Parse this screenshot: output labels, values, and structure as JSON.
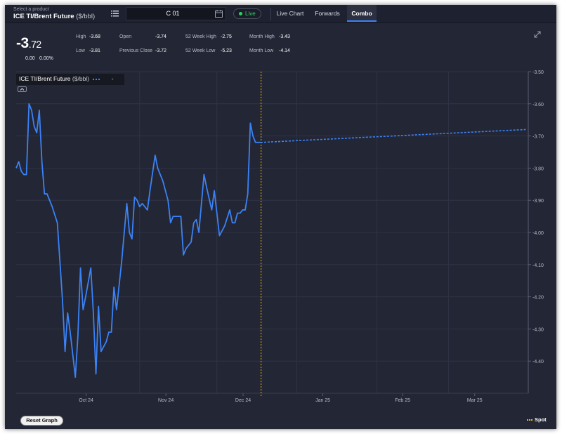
{
  "toolbar": {
    "product_caption": "Select a product",
    "product_name": "ICE TI/Brent Future",
    "product_unit": "($/bbl)",
    "contract": "C 01",
    "live_label": "Live",
    "tabs": [
      {
        "label": "Live Chart",
        "active": false
      },
      {
        "label": "Forwards",
        "active": false
      },
      {
        "label": "Combo",
        "active": true
      }
    ]
  },
  "quote": {
    "price_int": "-3",
    "price_dec": ".72",
    "change": "0.00",
    "change_pct": "0.00%",
    "stats": [
      {
        "label": "High",
        "value": "-3.68"
      },
      {
        "label": "Low",
        "value": "-3.81"
      },
      {
        "label": "Open",
        "value": "-3.74"
      },
      {
        "label": "Previous Close",
        "value": "-3.72"
      },
      {
        "label": "52 Week High",
        "value": "-2.75"
      },
      {
        "label": "52 Week Low",
        "value": "-5.23"
      },
      {
        "label": "Month High",
        "value": "-3.43"
      },
      {
        "label": "Month Low",
        "value": "-4.14"
      }
    ]
  },
  "legend": {
    "title": "ICE TI/Brent Future",
    "unit": "($/bbl)",
    "dash": "-"
  },
  "buttons": {
    "reset": "Reset Graph"
  },
  "spot_legend": "Spot",
  "colors": {
    "background": "#232634",
    "series": "#3b82f6",
    "spot": "#f5b800",
    "live": "#2fd05f"
  },
  "chart_data": {
    "type": "line",
    "title": "ICE TI/Brent Future ($/bbl)",
    "ylim": [
      -4.5,
      -3.5
    ],
    "y_ticks": [
      "-3.50",
      "-3.60",
      "-3.70",
      "-3.80",
      "-3.90",
      "-4.00",
      "-4.10",
      "-4.20",
      "-4.30",
      "-4.40"
    ],
    "x_tick_labels": [
      "Oct 24",
      "Nov 24",
      "Dec 24",
      "Jan 25",
      "Feb 25",
      "Mar 25"
    ],
    "x_range": [
      "2024-09-14",
      "2025-04-01"
    ],
    "grid": true,
    "spot_marker_date": "2024-12-16",
    "series": [
      {
        "name": "ICE TI/Brent Future",
        "style": "solid",
        "points": [
          [
            "2024-09-14",
            -3.8
          ],
          [
            "2024-09-15",
            -3.78
          ],
          [
            "2024-09-16",
            -3.81
          ],
          [
            "2024-09-17",
            -3.82
          ],
          [
            "2024-09-18",
            -3.82
          ],
          [
            "2024-09-19",
            -3.6
          ],
          [
            "2024-09-20",
            -3.62
          ],
          [
            "2024-09-21",
            -3.67
          ],
          [
            "2024-09-22",
            -3.69
          ],
          [
            "2024-09-23",
            -3.62
          ],
          [
            "2024-09-24",
            -3.78
          ],
          [
            "2024-09-25",
            -3.88
          ],
          [
            "2024-09-26",
            -3.88
          ],
          [
            "2024-09-28",
            -3.92
          ],
          [
            "2024-09-30",
            -3.97
          ],
          [
            "2024-10-02",
            -4.21
          ],
          [
            "2024-10-03",
            -4.37
          ],
          [
            "2024-10-04",
            -4.25
          ],
          [
            "2024-10-05",
            -4.31
          ],
          [
            "2024-10-07",
            -4.45
          ],
          [
            "2024-10-08",
            -4.32
          ],
          [
            "2024-10-09",
            -4.11
          ],
          [
            "2024-10-10",
            -4.24
          ],
          [
            "2024-10-11",
            -4.2
          ],
          [
            "2024-10-13",
            -4.11
          ],
          [
            "2024-10-14",
            -4.25
          ],
          [
            "2024-10-15",
            -4.44
          ],
          [
            "2024-10-16",
            -4.23
          ],
          [
            "2024-10-17",
            -4.37
          ],
          [
            "2024-10-19",
            -4.34
          ],
          [
            "2024-10-20",
            -4.31
          ],
          [
            "2024-10-21",
            -4.31
          ],
          [
            "2024-10-22",
            -4.17
          ],
          [
            "2024-10-23",
            -4.24
          ],
          [
            "2024-10-25",
            -4.09
          ],
          [
            "2024-10-27",
            -3.91
          ],
          [
            "2024-10-28",
            -4.0
          ],
          [
            "2024-10-29",
            -4.02
          ],
          [
            "2024-10-30",
            -3.89
          ],
          [
            "2024-10-31",
            -3.9
          ],
          [
            "2024-11-01",
            -3.92
          ],
          [
            "2024-11-02",
            -3.91
          ],
          [
            "2024-11-04",
            -3.93
          ],
          [
            "2024-11-05",
            -3.87
          ],
          [
            "2024-11-07",
            -3.76
          ],
          [
            "2024-11-08",
            -3.8
          ],
          [
            "2024-11-10",
            -3.84
          ],
          [
            "2024-11-12",
            -3.9
          ],
          [
            "2024-11-13",
            -3.97
          ],
          [
            "2024-11-14",
            -3.95
          ],
          [
            "2024-11-16",
            -3.95
          ],
          [
            "2024-11-17",
            -3.95
          ],
          [
            "2024-11-18",
            -4.07
          ],
          [
            "2024-11-19",
            -4.05
          ],
          [
            "2024-11-21",
            -4.03
          ],
          [
            "2024-11-22",
            -3.97
          ],
          [
            "2024-11-23",
            -3.96
          ],
          [
            "2024-11-24",
            -4.0
          ],
          [
            "2024-11-26",
            -3.82
          ],
          [
            "2024-11-27",
            -3.86
          ],
          [
            "2024-11-29",
            -3.93
          ],
          [
            "2024-11-30",
            -3.87
          ],
          [
            "2024-12-02",
            -4.01
          ],
          [
            "2024-12-04",
            -3.98
          ],
          [
            "2024-12-06",
            -3.93
          ],
          [
            "2024-12-07",
            -3.97
          ],
          [
            "2024-12-08",
            -3.97
          ],
          [
            "2024-12-09",
            -3.94
          ],
          [
            "2024-12-10",
            -3.94
          ],
          [
            "2024-12-11",
            -3.93
          ],
          [
            "2024-12-12",
            -3.93
          ],
          [
            "2024-12-13",
            -3.88
          ],
          [
            "2024-12-14",
            -3.66
          ],
          [
            "2024-12-15",
            -3.7
          ],
          [
            "2024-12-16",
            -3.72
          ],
          [
            "2024-12-18",
            -3.72
          ]
        ]
      },
      {
        "name": "Forward curve",
        "style": "dashed",
        "points": [
          [
            "2024-12-18",
            -3.72
          ],
          [
            "2025-03-31",
            -3.68
          ]
        ]
      }
    ]
  }
}
